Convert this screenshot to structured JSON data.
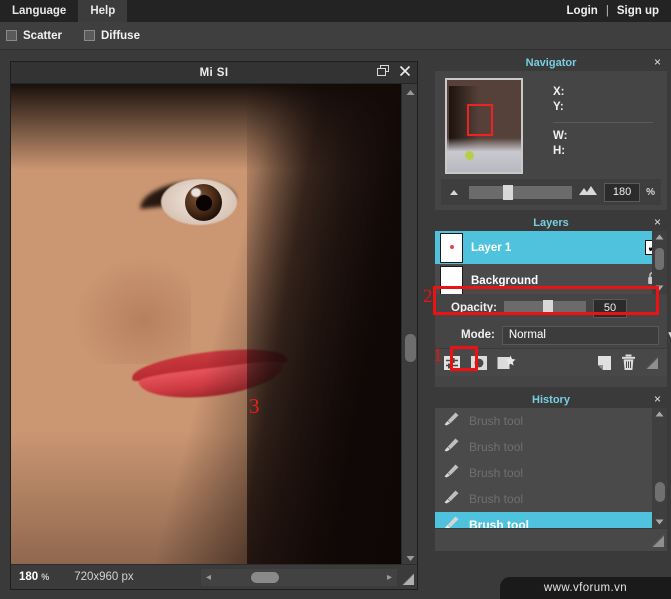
{
  "menubar": {
    "items": [
      {
        "label": "Language",
        "active": false
      },
      {
        "label": "Help",
        "active": true
      }
    ],
    "auth": {
      "login": "Login",
      "separator": "|",
      "signup": "Sign up"
    }
  },
  "options_bar": {
    "checkboxes": [
      {
        "label": "Scatter",
        "checked": false
      },
      {
        "label": "Diffuse",
        "checked": false
      }
    ]
  },
  "document": {
    "title": "Mi SI",
    "restore_icon": "restore-window-icon",
    "close_icon": "close-icon",
    "annotation": "3"
  },
  "statusbar": {
    "zoom": "180",
    "zoom_unit": "%",
    "dimensions": "720x960 px",
    "left_arrow": "◂",
    "right_arrow": "▸",
    "grip_icon": "resize-grip-icon"
  },
  "navigator": {
    "title": "Navigator",
    "close": "×",
    "fields": [
      {
        "label": "X:",
        "value": ""
      },
      {
        "label": "Y:",
        "value": ""
      },
      {
        "label": "W:",
        "value": ""
      },
      {
        "label": "H:",
        "value": ""
      }
    ],
    "zoom_out_icon": "zoom-out-mountain-icon",
    "zoom_in_icon": "zoom-in-mountain-icon",
    "zoom_value": "180",
    "zoom_unit": "%"
  },
  "layers": {
    "title": "Layers",
    "close": "×",
    "items": [
      {
        "name": "Layer 1",
        "selected": true,
        "visible": true,
        "locked": false,
        "check": "✔"
      },
      {
        "name": "Background",
        "selected": false,
        "visible": true,
        "locked": true,
        "lock_icon": "lock-icon"
      }
    ],
    "opacity_label": "Opacity:",
    "opacity_value": "50",
    "mode_label": "Mode:",
    "mode_value": "Normal",
    "caret": "▼",
    "toolbar": [
      {
        "icon": "layer-settings-icon",
        "name": "layer-settings-button"
      },
      {
        "icon": "layer-mask-icon",
        "name": "layer-mask-button"
      },
      {
        "icon": "add-layer-icon",
        "name": "add-layer-button"
      },
      {
        "icon": "duplicate-layer-icon",
        "name": "duplicate-layer-button"
      },
      {
        "icon": "delete-layer-icon",
        "name": "delete-layer-button"
      },
      {
        "icon": "resize-grip-icon",
        "name": "layers-resize-grip"
      }
    ],
    "annotation_1": "1",
    "annotation_2": "2"
  },
  "history": {
    "title": "History",
    "close": "×",
    "items": [
      {
        "label": "Brush tool",
        "selected": false
      },
      {
        "label": "Brush tool",
        "selected": false
      },
      {
        "label": "Brush tool",
        "selected": false
      },
      {
        "label": "Brush tool",
        "selected": false
      },
      {
        "label": "Brush tool",
        "selected": true
      }
    ],
    "icon": "brush-tool-icon",
    "grip_icon": "resize-grip-icon"
  },
  "watermark": {
    "text": "www.vforum.vn"
  },
  "colors": {
    "accent": "#4fc3dd",
    "panel_title": "#77cfe0",
    "annotation_red": "#ee1111",
    "panel_bg": "#454545",
    "app_bg": "#3a3a3a"
  }
}
